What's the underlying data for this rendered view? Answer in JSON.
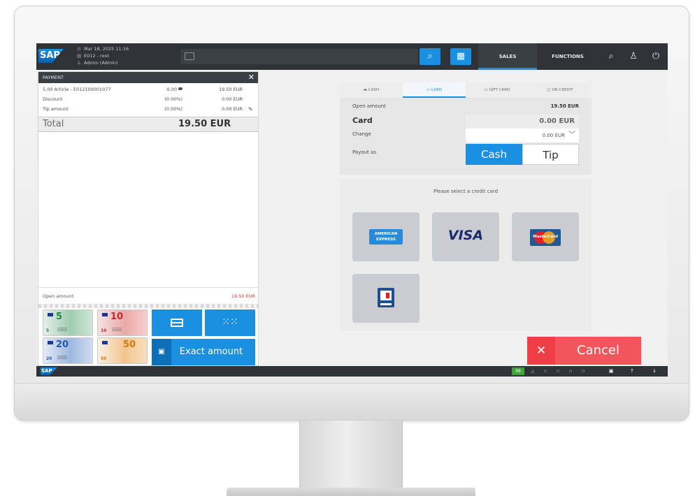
{
  "topbar": {
    "logo": "SAP",
    "datetime": "Mar 18, 2025 11:16",
    "terminal": "E012 - root",
    "user": "Admin (Admin)",
    "tabs": {
      "sales": "SALES",
      "functions": "FUNCTIONS"
    }
  },
  "payment_panel": {
    "header": "PAYMENT",
    "lines": [
      {
        "description": "5.00 Article - E012100001077",
        "rate": "0.00",
        "amount": "19.50 EUR"
      },
      {
        "description": "Discount",
        "rate": "(0.00%)",
        "amount": "0.00 EUR"
      },
      {
        "description": "Tip amount",
        "rate": "(0.00%)",
        "amount": "0.00 EUR"
      }
    ],
    "total_label": "Total",
    "total_value": "19.50 EUR",
    "open_amount_label": "Open amount",
    "open_amount_value": "19.50 EUR"
  },
  "banknotes": [
    {
      "value": "5",
      "small": "5"
    },
    {
      "value": "10",
      "small": "10"
    },
    {
      "value": "20",
      "small": "20"
    },
    {
      "value": "50",
      "small": "50"
    }
  ],
  "actions": {
    "exact_amount": "Exact amount"
  },
  "payment_tabs": [
    {
      "label": "CASH",
      "active": false
    },
    {
      "label": "CARD",
      "active": true
    },
    {
      "label": "GIFT CARD",
      "active": false
    },
    {
      "label": "ON CREDIT",
      "active": false
    }
  ],
  "summary": {
    "open_amount_label": "Open amount",
    "open_amount_value": "19.50 EUR",
    "card_label": "Card",
    "card_value": "0.00 EUR",
    "change_label": "Change",
    "change_value": "0.00 EUR",
    "payout_label": "Payout as",
    "payout_cash": "Cash",
    "payout_tip": "Tip"
  },
  "card_select": {
    "prompt": "Please select a credit card",
    "cards": [
      {
        "name": "American Express",
        "line1": "AMERICAN",
        "line2": "EXPRESS"
      },
      {
        "name": "Visa",
        "text": "VISA"
      },
      {
        "name": "MasterCard",
        "text": "MasterCard"
      },
      {
        "name": "EC"
      }
    ]
  },
  "cancel": {
    "label": "Cancel"
  },
  "statusbar": {
    "logo": "SAP",
    "count": "99"
  },
  "colors": {
    "accent": "#1b8fe0",
    "danger": "#f2565c",
    "topbar": "#2f3337"
  }
}
